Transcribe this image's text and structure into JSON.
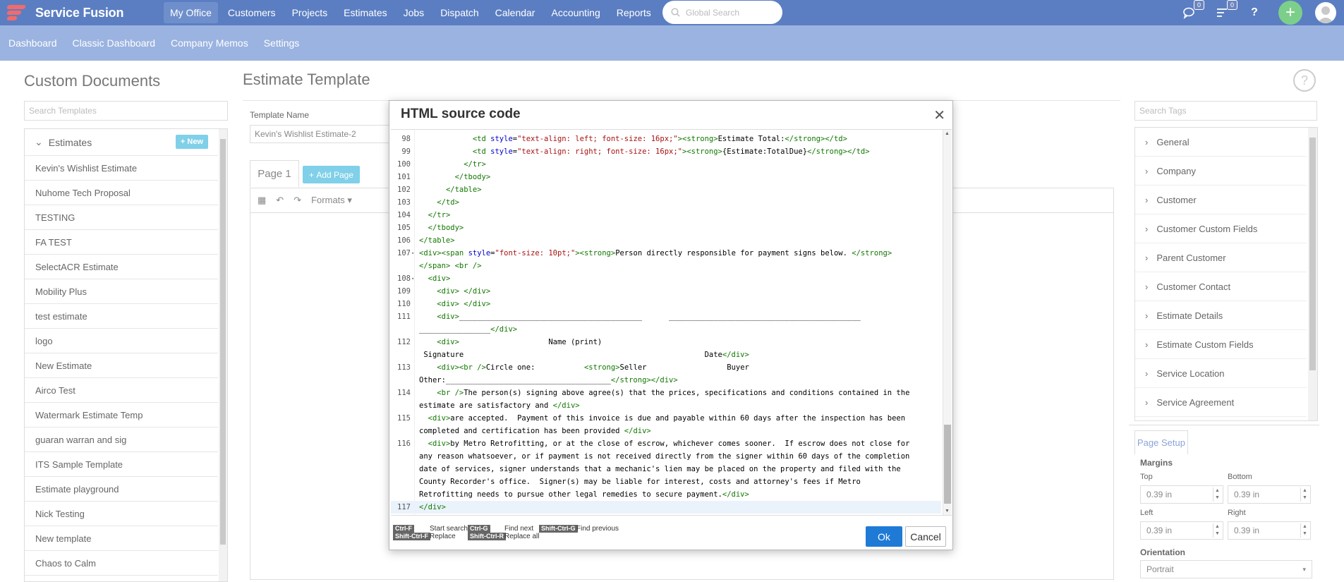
{
  "app": {
    "name": "Service Fusion"
  },
  "nav": {
    "items": [
      "My Office",
      "Customers",
      "Projects",
      "Estimates",
      "Jobs",
      "Dispatch",
      "Calendar",
      "Accounting",
      "Reports"
    ],
    "active": "My Office"
  },
  "global_search": {
    "placeholder": "Global Search"
  },
  "notifications": {
    "chat_count": "0",
    "list_count": "0"
  },
  "subnav": {
    "items": [
      "Dashboard",
      "Classic Dashboard",
      "Company Memos",
      "Settings"
    ]
  },
  "left": {
    "title": "Custom Documents",
    "search_placeholder": "Search Templates",
    "group_label": "Estimates",
    "new_label": "New",
    "templates": [
      "Kevin's Wishlist Estimate",
      "Nuhome Tech Proposal",
      "TESTING",
      "FA TEST",
      "SelectACR Estimate",
      "Mobility Plus",
      "test estimate",
      "logo",
      "New Estimate",
      "Airco Test",
      "Watermark Estimate Temp",
      "guaran warran and sig",
      "ITS Sample Template",
      "Estimate playground",
      "Nick Testing",
      "New template",
      "Chaos to Calm"
    ]
  },
  "main": {
    "title": "Estimate Template",
    "template_name_label": "Template Name",
    "template_name_value": "Kevin's Wishlist Estimate-2",
    "page_tab": "Page 1",
    "add_page": "Add Page",
    "formats_label": "Formats"
  },
  "right": {
    "search_placeholder": "Search Tags",
    "tags": [
      "General",
      "Company",
      "Customer",
      "Customer Custom Fields",
      "Parent Customer",
      "Customer Contact",
      "Estimate Details",
      "Estimate Custom Fields",
      "Service Location",
      "Service Agreement"
    ],
    "page_setup": {
      "tab": "Page Setup",
      "margins_label": "Margins",
      "top_label": "Top",
      "top_value": "0.39 in",
      "bottom_label": "Bottom",
      "bottom_value": "0.39 in",
      "left_label": "Left",
      "left_value": "0.39 in",
      "right_label": "Right",
      "right_value": "0.39 in",
      "orientation_label": "Orientation",
      "orientation_value": "Portrait"
    }
  },
  "modal": {
    "title": "HTML source code",
    "ok": "Ok",
    "cancel": "Cancel",
    "shortcuts": [
      {
        "key": "Ctrl-F",
        "label": "Start search"
      },
      {
        "key": "Ctrl-G",
        "label": "Find next"
      },
      {
        "key": "Shift-Ctrl-G",
        "label": "Find previous"
      },
      {
        "key": "Shift-Ctrl-F",
        "label": "Replace"
      },
      {
        "key": "Shift-Ctrl-R",
        "label": "Replace all"
      }
    ],
    "code_lines": [
      {
        "n": "98",
        "text": "            <td style=\"text-align: left; font-size: 16px;\"><strong>Estimate Total:</strong></td>"
      },
      {
        "n": "99",
        "text": "            <td style=\"text-align: right; font-size: 16px;\"><strong>{Estimate:TotalDue}</strong></td>"
      },
      {
        "n": "100",
        "text": "          </tr>"
      },
      {
        "n": "101",
        "text": "        </tbody>"
      },
      {
        "n": "102",
        "text": "      </table>"
      },
      {
        "n": "103",
        "text": "    </td>"
      },
      {
        "n": "104",
        "text": "  </tr>"
      },
      {
        "n": "105",
        "text": "  </tbody>"
      },
      {
        "n": "106",
        "text": "</table>"
      },
      {
        "n": "107",
        "text": "<div><span style=\"font-size: 10pt;\"><strong>Person directly responsible for payment signs below. </strong>",
        "fold": true
      },
      {
        "n": "",
        "text": "</span> <br />"
      },
      {
        "n": "108",
        "text": "  <div>",
        "fold": true
      },
      {
        "n": "109",
        "text": "    <div> </div>"
      },
      {
        "n": "110",
        "text": "    <div> </div>"
      },
      {
        "n": "111",
        "text": "    <div>_________________________________________      ___________________________________________"
      },
      {
        "n": "",
        "text": "________________</div>"
      },
      {
        "n": "112",
        "text": "    <div>                    Name (print)"
      },
      {
        "n": "",
        "text": " Signature                                                      Date</div>"
      },
      {
        "n": "113",
        "text": "    <div><br />Circle one:           <strong>Seller                  Buyer"
      },
      {
        "n": "",
        "text": "Other:_____________________________________</strong></div>"
      },
      {
        "n": "114",
        "text": "    <br />The person(s) signing above agree(s) that the prices, specifications and conditions contained in the"
      },
      {
        "n": "",
        "text": "estimate are satisfactory and </div>"
      },
      {
        "n": "115",
        "text": "  <div>are accepted.  Payment of this invoice is due and payable within 60 days after the inspection has been"
      },
      {
        "n": "",
        "text": "completed and certification has been provided </div>"
      },
      {
        "n": "116",
        "text": "  <div>by Metro Retrofitting, or at the close of escrow, whichever comes sooner.  If escrow does not close for"
      },
      {
        "n": "",
        "text": "any reason whatsoever, or if payment is not received directly from the signer within 60 days of the completion"
      },
      {
        "n": "",
        "text": "date of services, signer understands that a mechanic's lien may be placed on the property and filed with the"
      },
      {
        "n": "",
        "text": "County Recorder's office.  Signer(s) may be liable for interest, costs and attorney's fees if Metro"
      },
      {
        "n": "",
        "text": "Retrofitting needs to pursue other legal remedies to secure payment.</div>"
      },
      {
        "n": "117",
        "text": "</div>",
        "active": true
      }
    ]
  }
}
